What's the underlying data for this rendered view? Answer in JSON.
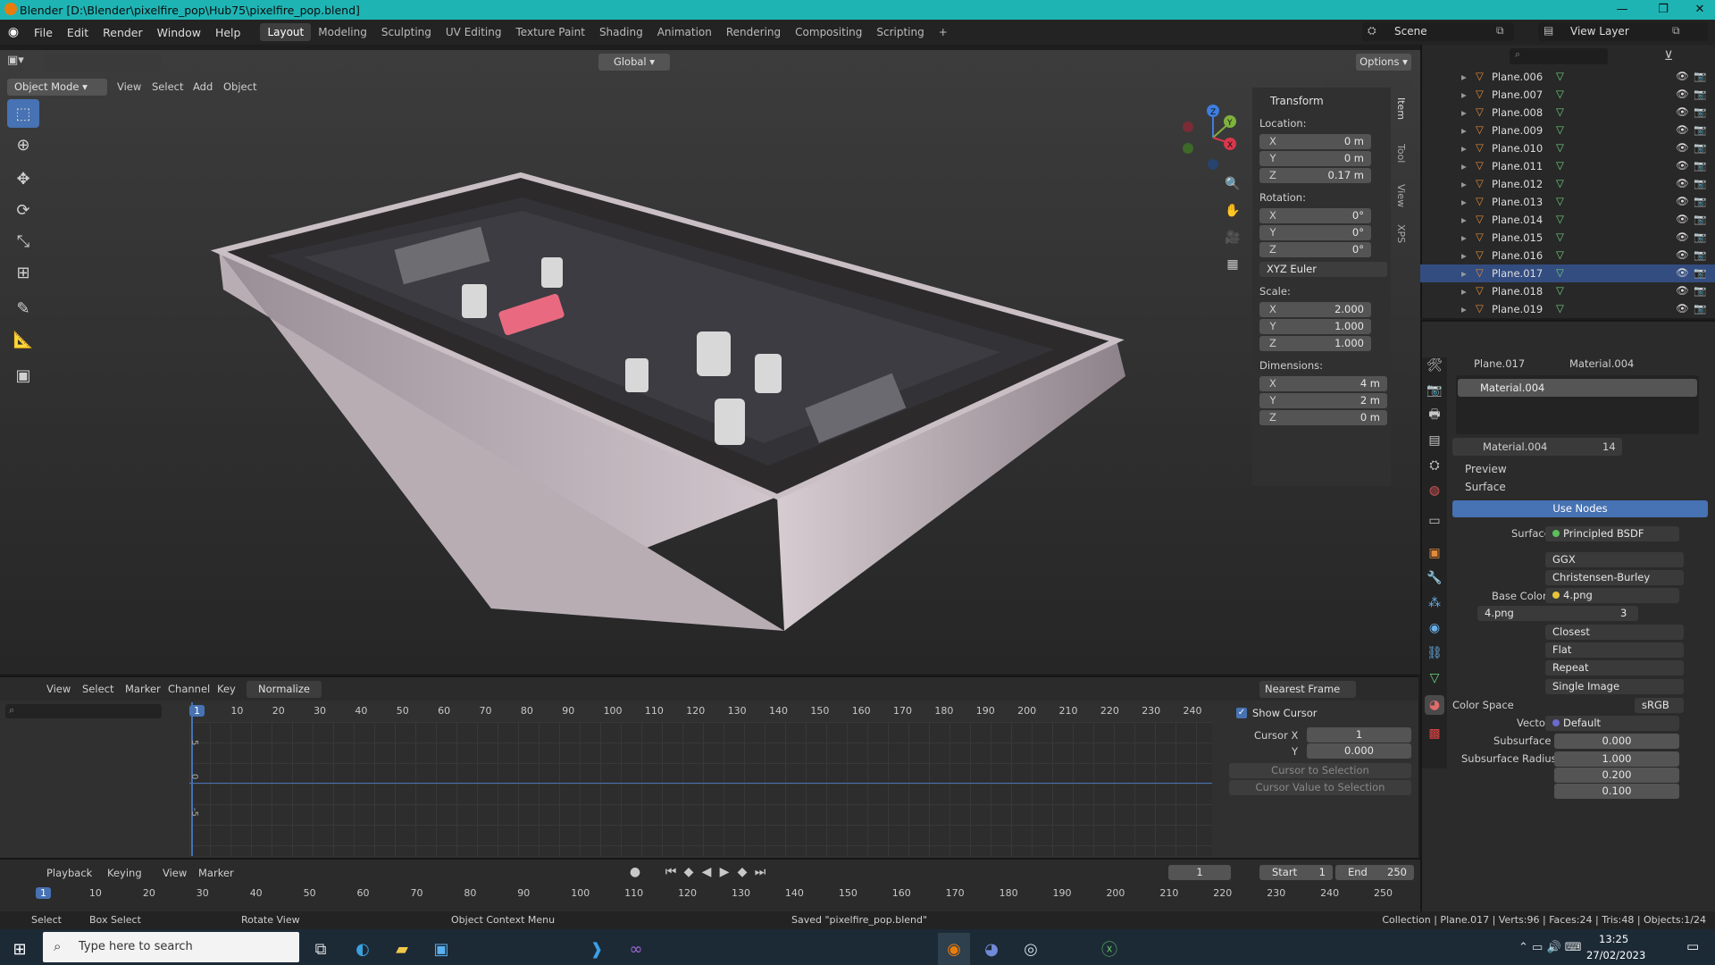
{
  "window": {
    "title": "Blender [D:\\Blender\\pixelfire_pop\\Hub75\\pixelfire_pop.blend]",
    "min": "—",
    "max": "❐",
    "close": "✕"
  },
  "menu": [
    "File",
    "Edit",
    "Render",
    "Window",
    "Help"
  ],
  "workspaces": [
    "Layout",
    "Modeling",
    "Sculpting",
    "UV Editing",
    "Texture Paint",
    "Shading",
    "Animation",
    "Rendering",
    "Compositing",
    "Scripting",
    "+"
  ],
  "scene": {
    "label": "Scene",
    "view_layer": "View Layer"
  },
  "viewport": {
    "mode": "Object Mode",
    "menus": [
      "View",
      "Select",
      "Add",
      "Object"
    ],
    "orientation": "Global",
    "options": "Options"
  },
  "npanel": {
    "tabs": [
      "Item",
      "Tool",
      "View",
      "XPS"
    ],
    "title": "Transform",
    "location_label": "Location:",
    "rotation_label": "Rotation:",
    "scale_label": "Scale:",
    "dimensions_label": "Dimensions:",
    "rotation_mode": "XYZ Euler",
    "location": [
      {
        "axis": "X",
        "value": "0 m"
      },
      {
        "axis": "Y",
        "value": "0 m"
      },
      {
        "axis": "Z",
        "value": "0.17 m"
      }
    ],
    "rotation": [
      {
        "axis": "X",
        "value": "0°"
      },
      {
        "axis": "Y",
        "value": "0°"
      },
      {
        "axis": "Z",
        "value": "0°"
      }
    ],
    "scale": [
      {
        "axis": "X",
        "value": "2.000"
      },
      {
        "axis": "Y",
        "value": "1.000"
      },
      {
        "axis": "Z",
        "value": "1.000"
      }
    ],
    "dimensions": [
      {
        "axis": "X",
        "value": "4 m"
      },
      {
        "axis": "Y",
        "value": "2 m"
      },
      {
        "axis": "Z",
        "value": "0 m"
      }
    ]
  },
  "gizmo": {
    "x": "X",
    "y": "Y",
    "z": "Z"
  },
  "outliner": {
    "items": [
      "Plane.006",
      "Plane.007",
      "Plane.008",
      "Plane.009",
      "Plane.010",
      "Plane.011",
      "Plane.012",
      "Plane.013",
      "Plane.014",
      "Plane.015",
      "Plane.016",
      "Plane.017",
      "Plane.018",
      "Plane.019"
    ],
    "selected_index": 11
  },
  "properties": {
    "object": "Plane.017",
    "material": "Material.004",
    "slot": "Material.004",
    "material_users": "14",
    "preview": "Preview",
    "surface_section": "Surface",
    "use_nodes": "Use Nodes",
    "surface_label": "Surface",
    "surface_value": "Principled BSDF",
    "distribution": "GGX",
    "subsurface_method": "Christensen-Burley",
    "base_color_label": "Base Color",
    "base_color_value": "4.png",
    "image": "4.png",
    "image_users": "3",
    "interpolation": "Closest",
    "projection": "Flat",
    "extension": "Repeat",
    "source": "Single Image",
    "color_space_label": "Color Space",
    "color_space": "sRGB",
    "vector_label": "Vector",
    "vector_value": "Default",
    "subsurface_label": "Subsurface",
    "subsurface_value": "0.000",
    "subsurface_radius_label": "Subsurface Radius",
    "subsurface_radius": [
      "1.000",
      "0.200",
      "0.100"
    ]
  },
  "graph": {
    "menus": [
      "View",
      "Select",
      "Marker",
      "Channel",
      "Key"
    ],
    "normalize": "Normalize",
    "snap": "Nearest Frame",
    "ruler": [
      "1",
      "10",
      "20",
      "30",
      "40",
      "50",
      "60",
      "70",
      "80",
      "90",
      "100",
      "110",
      "120",
      "130",
      "140",
      "150",
      "160",
      "170",
      "180",
      "190",
      "200",
      "210",
      "220",
      "230",
      "240"
    ],
    "yticks": [
      "5",
      "0",
      "-5"
    ],
    "show_cursor": "Show Cursor",
    "cursor_x_label": "Cursor X",
    "cursor_x": "1",
    "cursor_y_label": "Y",
    "cursor_y": "0.000",
    "cursor_to_selection": "Cursor to Selection",
    "cursor_value_to_selection": "Cursor Value to Selection"
  },
  "timeline": {
    "menus": [
      "Playback",
      "Keying",
      "View",
      "Marker"
    ],
    "current_frame": "1",
    "start_label": "Start",
    "start": "1",
    "end_label": "End",
    "end": "250",
    "ruler": [
      "1",
      "10",
      "20",
      "30",
      "40",
      "50",
      "60",
      "70",
      "80",
      "90",
      "100",
      "110",
      "120",
      "130",
      "140",
      "150",
      "160",
      "170",
      "180",
      "190",
      "200",
      "210",
      "220",
      "230",
      "240",
      "250"
    ]
  },
  "status": {
    "select": "Select",
    "box_select": "Box Select",
    "rotate_view": "Rotate View",
    "context_menu": "Object Context Menu",
    "saved": "Saved \"pixelfire_pop.blend\"",
    "stats": "Collection | Plane.017 | Verts:96 | Faces:24 | Tris:48 | Objects:1/24"
  },
  "taskbar": {
    "search_placeholder": "Type here to search",
    "time": "13:25",
    "date": "27/02/2023"
  },
  "colors": {
    "accent": "#4772b3",
    "titlebar": "#1fb4b4",
    "selected_row": "#334d80",
    "orange": "#e08b3c"
  }
}
